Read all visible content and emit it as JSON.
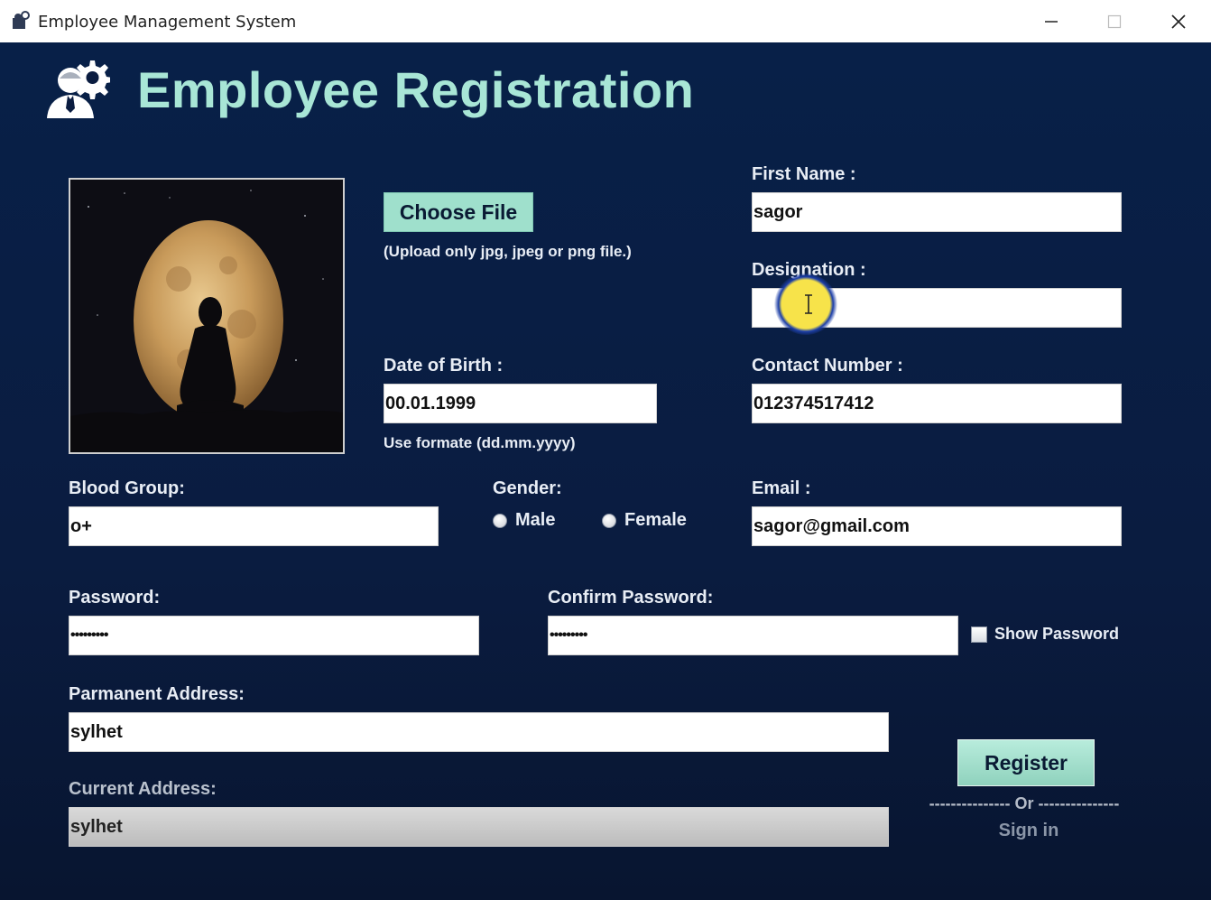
{
  "window": {
    "title": "Employee Management System"
  },
  "header": {
    "title": "Employee Registration"
  },
  "photo": {
    "choose_label": "Choose File",
    "hint": "(Upload only jpg, jpeg or png file.)"
  },
  "form": {
    "first_name": {
      "label": "First Name :",
      "value": "sagor"
    },
    "designation": {
      "label": "Designation :",
      "value": ""
    },
    "dob": {
      "label": "Date of Birth :",
      "value": "00.01.1999",
      "hint": "Use formate (dd.mm.yyyy)"
    },
    "contact": {
      "label": "Contact Number :",
      "value": "012374517412"
    },
    "blood_group": {
      "label": "Blood Group:",
      "value": "o+"
    },
    "gender": {
      "label": "Gender:",
      "options": [
        "Male",
        "Female"
      ],
      "selected": ""
    },
    "email": {
      "label": "Email :",
      "value": "sagor@gmail.com"
    },
    "password": {
      "label": "Password:",
      "value": "•••••••••"
    },
    "confirm_password": {
      "label": "Confirm Password:",
      "value": "•••••••••"
    },
    "show_password": {
      "label": "Show Password",
      "checked": false
    },
    "permanent_address": {
      "label": "Parmanent Address:",
      "value": "sylhet"
    },
    "current_address": {
      "label": "Current Address:",
      "value": "sylhet"
    }
  },
  "actions": {
    "register_label": "Register",
    "or_separator": "--------------- Or ---------------",
    "signin_label": "Sign in"
  },
  "icons": {
    "app": "app-logo-icon",
    "minimize": "minimize-icon",
    "maximize": "maximize-icon",
    "close": "close-icon",
    "logo": "employee-gear-icon"
  },
  "colors": {
    "background": "#0a1c40",
    "title": "#a8e6d6",
    "accent_button": "#9fe0cc"
  }
}
